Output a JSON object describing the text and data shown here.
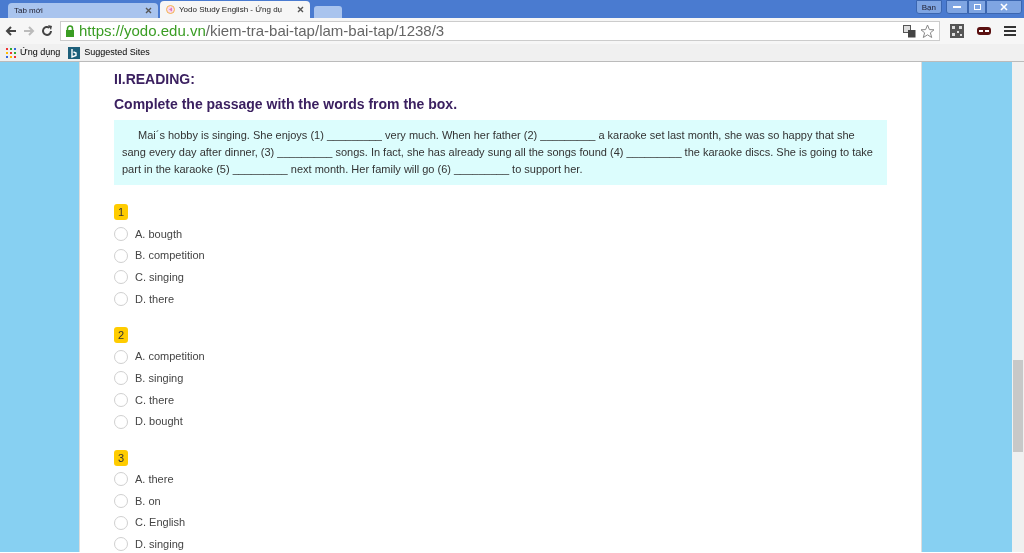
{
  "browser": {
    "tabs": [
      {
        "title": "Tab mới",
        "selected": false
      },
      {
        "title": "Yodo Study English - Ứng dụ",
        "selected": true
      }
    ],
    "profile": "Bạn",
    "url_host": "https://yodo.edu.vn",
    "url_path": "/kiem-tra-bai-tap/lam-bai-tap/1238/3",
    "bookmarks": [
      "Ứng dụng",
      "Suggested Sites"
    ]
  },
  "section_title": "II.READING:",
  "instruction": "Complete the passage with the words from the box.",
  "passage": "Mai´s hobby is singing. She enjoys (1) _________ very much. When her father (2) _________ a karaoke set last month, she was so happy that she sang every day after dinner, (3) _________ songs. In fact, she has already sung all the songs found (4) _________ the karaoke discs. She is going to take part in the karaoke (5) _________ next month. Her family will go (6) _________  to support her.",
  "questions": [
    {
      "number": "1",
      "options": [
        {
          "label": "A. bougth",
          "selected": false
        },
        {
          "label": "B. competition",
          "selected": false
        },
        {
          "label": "C. singing",
          "selected": false
        },
        {
          "label": "D. there",
          "selected": false
        }
      ]
    },
    {
      "number": "2",
      "options": [
        {
          "label": "A. competition",
          "selected": false
        },
        {
          "label": "B. singing",
          "selected": false
        },
        {
          "label": "C. there",
          "selected": false
        },
        {
          "label": "D. bought",
          "selected": false
        }
      ]
    },
    {
      "number": "3",
      "options": [
        {
          "label": "A. there",
          "selected": false
        },
        {
          "label": "B. on",
          "selected": false
        },
        {
          "label": "C. English",
          "selected": false
        },
        {
          "label": "D. singing",
          "selected": false
        }
      ]
    }
  ]
}
